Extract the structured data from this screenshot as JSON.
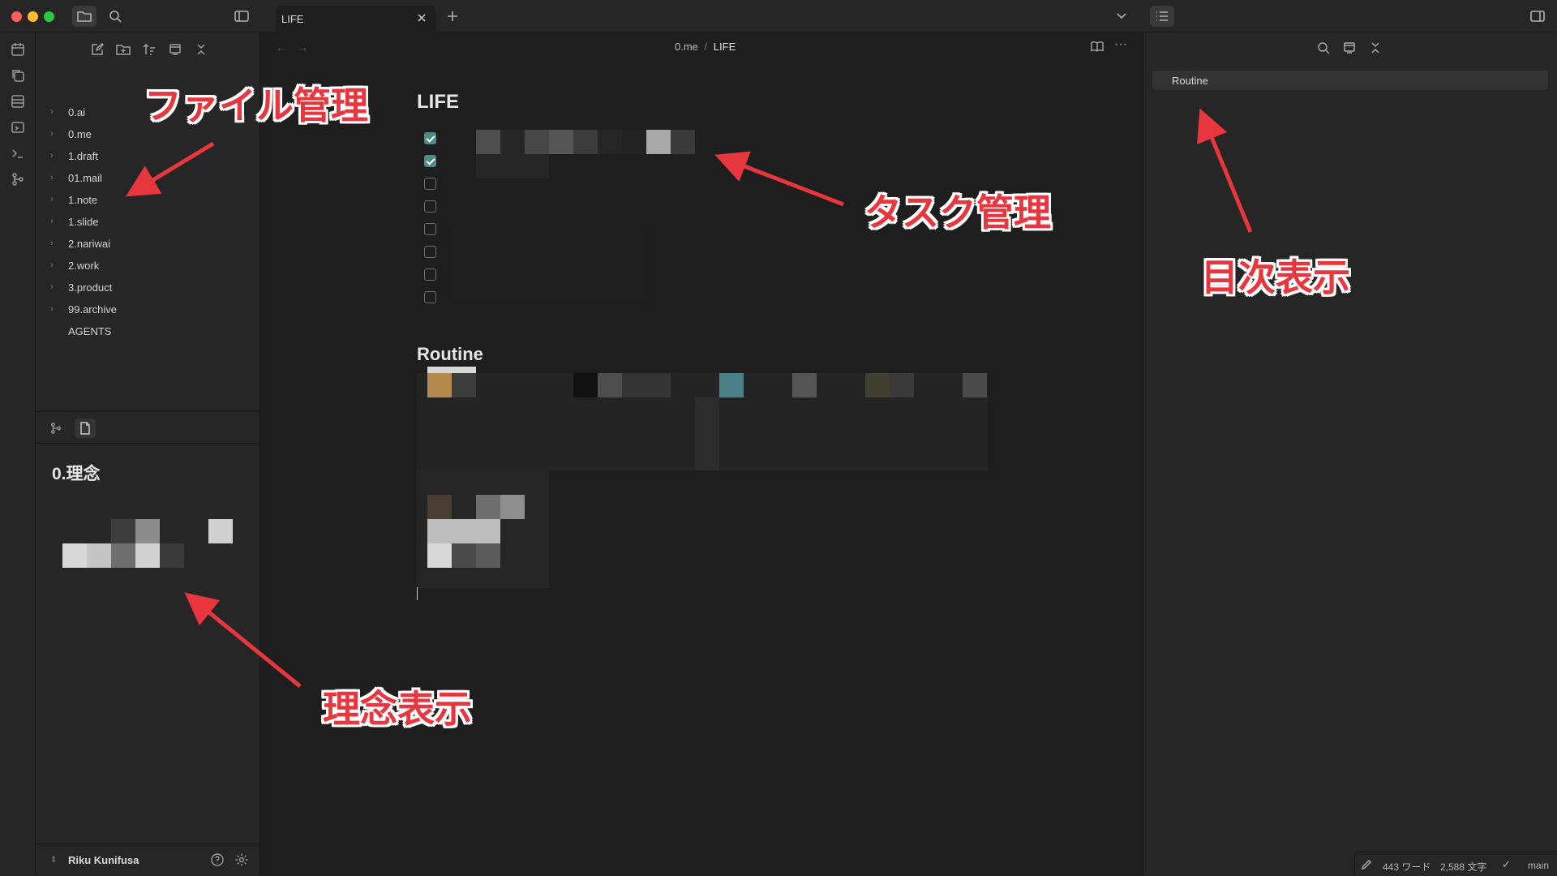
{
  "window": {
    "tab_title": "LIFE"
  },
  "file_tree": {
    "items": [
      {
        "label": "0.ai",
        "folder": true
      },
      {
        "label": "0.me",
        "folder": true
      },
      {
        "label": "1.draft",
        "folder": true
      },
      {
        "label": "01.mail",
        "folder": true
      },
      {
        "label": "1.note",
        "folder": true
      },
      {
        "label": "1.slide",
        "folder": true
      },
      {
        "label": "2.nariwai",
        "folder": true
      },
      {
        "label": "2.work",
        "folder": true
      },
      {
        "label": "3.product",
        "folder": true
      },
      {
        "label": "99.archive",
        "folder": true
      },
      {
        "label": "AGENTS",
        "folder": false
      }
    ]
  },
  "philosophy": {
    "title": "0.理念"
  },
  "user": {
    "name": "Riku Kunifusa"
  },
  "editor": {
    "breadcrumb_parent": "0.me",
    "breadcrumb_sep": "/",
    "breadcrumb_current": "LIFE",
    "heading_life": "LIFE",
    "heading_routine": "Routine",
    "tasks": [
      {
        "checked": true
      },
      {
        "checked": true
      },
      {
        "checked": false
      },
      {
        "checked": false
      },
      {
        "checked": false
      },
      {
        "checked": false
      },
      {
        "checked": false
      },
      {
        "checked": false
      }
    ]
  },
  "outline": {
    "items": [
      "Routine"
    ]
  },
  "status": {
    "words": "443 ワード",
    "chars": "2,588 文字",
    "branch": "main"
  },
  "annotations": {
    "file_mgmt": "ファイル管理",
    "task_mgmt": "タスク管理",
    "toc": "目次表示",
    "philosophy": "理念表示"
  },
  "colors": {
    "accent_red": "#e8363f",
    "checkbox_teal": "#4a8f86",
    "bg_editor": "#1e1e1e",
    "bg_panel": "#262626"
  }
}
